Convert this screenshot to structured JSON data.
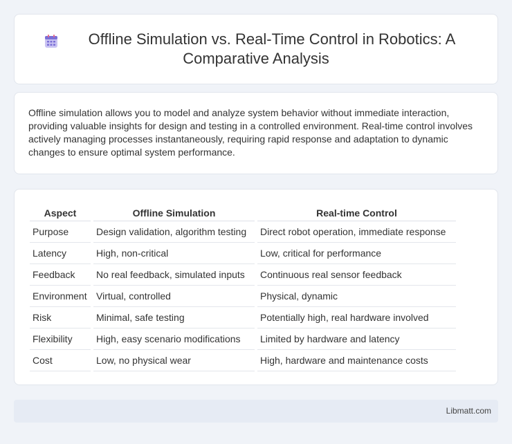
{
  "header": {
    "title": "Offline Simulation vs. Real-Time Control in Robotics: A Comparative Analysis",
    "icon": "calendar-icon"
  },
  "intro": {
    "text": "Offline simulation allows you to model and analyze system behavior without immediate interaction, providing valuable insights for design and testing in a controlled environment. Real-time control involves actively managing processes instantaneously, requiring rapid response and adaptation to dynamic changes to ensure optimal system performance."
  },
  "table": {
    "headers": [
      "Aspect",
      "Offline Simulation",
      "Real-time Control"
    ],
    "rows": [
      [
        "Purpose",
        "Design validation, algorithm testing",
        "Direct robot operation, immediate response"
      ],
      [
        "Latency",
        "High, non-critical",
        "Low, critical for performance"
      ],
      [
        "Feedback",
        "No real feedback, simulated inputs",
        "Continuous real sensor feedback"
      ],
      [
        "Environment",
        "Virtual, controlled",
        "Physical, dynamic"
      ],
      [
        "Risk",
        "Minimal, safe testing",
        "Potentially high, real hardware involved"
      ],
      [
        "Flexibility",
        "High, easy scenario modifications",
        "Limited by hardware and latency"
      ],
      [
        "Cost",
        "Low, no physical wear",
        "High, hardware and maintenance costs"
      ]
    ]
  },
  "footer": {
    "brand": "Libmatt.com"
  },
  "colors": {
    "background": "#f0f3f8",
    "card": "#ffffff",
    "footer": "#e6ebf4",
    "icon_accent": "#7b6fd6"
  }
}
